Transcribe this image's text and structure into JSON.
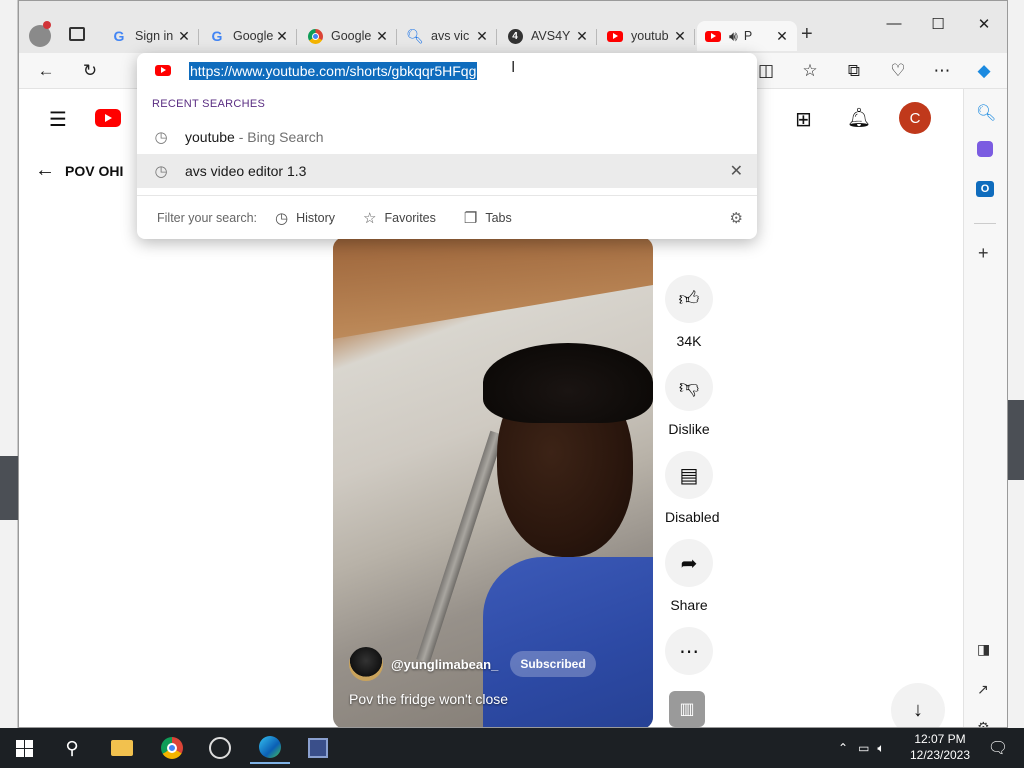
{
  "window": {
    "tabs": [
      {
        "title": "Sign in",
        "icon": "google-icon"
      },
      {
        "title": "Google",
        "icon": "google-icon"
      },
      {
        "title": "Google",
        "icon": "chrome-icon"
      },
      {
        "title": "avs vic",
        "icon": "search-icon"
      },
      {
        "title": "AVS4Y",
        "icon": "avs-icon"
      },
      {
        "title": "youtub",
        "icon": "youtube-icon"
      },
      {
        "title": "P",
        "icon": "youtube-icon"
      }
    ],
    "new_tab_label": "+",
    "controls": {
      "minimize": "—",
      "maximize": "☐",
      "close": "✕"
    }
  },
  "omnibox": {
    "url": "https://www.youtube.com/shorts/gbkqqr5HFqg",
    "recent_header": "RECENT SEARCHES",
    "suggestions": [
      {
        "main": "youtube",
        "secondary": "- Bing Search"
      },
      {
        "main": "avs video editor 1.3",
        "secondary": ""
      }
    ],
    "filter_label": "Filter your search:",
    "filters": [
      "History",
      "Favorites",
      "Tabs"
    ]
  },
  "page": {
    "back_title": "POV OHI",
    "avatar_letter": "C",
    "channel": "@yunglimabean_",
    "subscribe_state": "Subscribed",
    "caption": "Pov the fridge won't close",
    "actions": [
      {
        "icon": "thumbs-up-icon",
        "label": "34K"
      },
      {
        "icon": "thumbs-down-icon",
        "label": "Dislike"
      },
      {
        "icon": "comment-icon",
        "label": "Disabled"
      },
      {
        "icon": "share-icon",
        "label": "Share"
      },
      {
        "icon": "more-icon",
        "label": ""
      }
    ]
  },
  "taskbar": {
    "time": "12:07 PM",
    "date": "12/23/2023"
  },
  "colors": {
    "accent_red": "#ff0000",
    "avatar_bg": "#c0391b",
    "url_highlight": "#0f6cbd"
  }
}
